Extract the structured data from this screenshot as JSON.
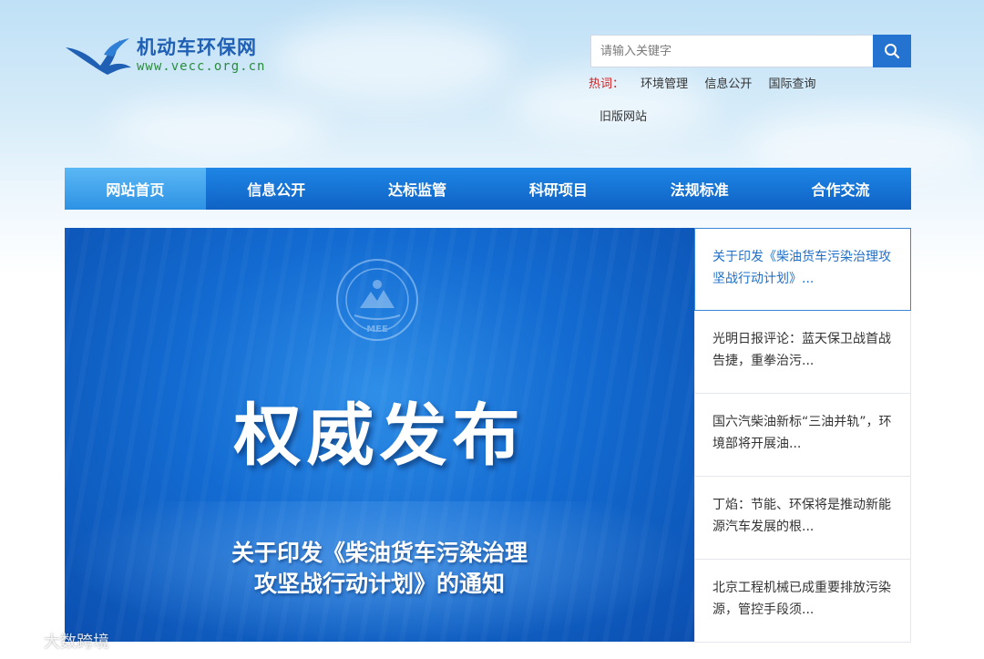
{
  "header": {
    "site_name": "机动车环保网",
    "site_url": "www.vecc.org.cn",
    "logo_icon": "bird-wing-logo"
  },
  "search": {
    "placeholder": "请输入关键字",
    "icon": "search-icon"
  },
  "hot": {
    "label": "热词：",
    "links": [
      "环境管理",
      "信息公开",
      "国际查询"
    ],
    "old_site": "旧版网站"
  },
  "nav": {
    "items": [
      "网站首页",
      "信息公开",
      "达标监管",
      "科研项目",
      "法规标准",
      "合作交流"
    ],
    "active_index": 0
  },
  "banner": {
    "title": "权威发布",
    "subtitle_line1": "关于印发《柴油货车污染治理",
    "subtitle_line2": "攻坚战行动计划》的通知",
    "emblem_text": "MEE"
  },
  "news": {
    "items": [
      "关于印发《柴油货车污染治理攻坚战行动计划》...",
      "光明日报评论：蓝天保卫战首战告捷，重拳治污...",
      "国六汽柴油新标“三油并轨”，环境部将开展油...",
      "丁焰：节能、环保将是推动新能源汽车发展的根...",
      "北京工程机械已成重要排放污染源，管控手段须..."
    ],
    "active_index": 0
  },
  "watermark": "大数跨境",
  "colors": {
    "nav_bg": "#0f62c4",
    "nav_active": "#2e92e4",
    "link_active": "#1f6fc8",
    "hot_label": "#d21f1f",
    "url_green": "#2b8c3e"
  }
}
